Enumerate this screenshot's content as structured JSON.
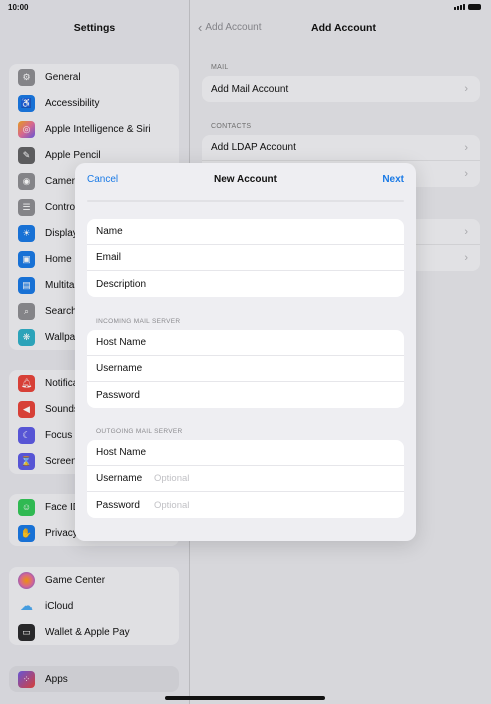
{
  "status_bar": {
    "time": "10:00"
  },
  "sidebar": {
    "title": "Settings",
    "groups": [
      [
        {
          "label": "General",
          "icon": "gear-icon",
          "color": "#8e8e93"
        },
        {
          "label": "Accessibility",
          "icon": "accessibility-icon",
          "color": "#1a7ae6"
        },
        {
          "label": "Apple Intelligence & Siri",
          "icon": "siri-icon",
          "color": "#e8709a"
        },
        {
          "label": "Apple Pencil",
          "icon": "pencil-icon",
          "color": "#636366"
        },
        {
          "label": "Camera",
          "icon": "camera-icon",
          "color": "#8e8e93"
        },
        {
          "label": "Control Centre",
          "icon": "control-centre-icon",
          "color": "#8e8e93"
        },
        {
          "label": "Display & Brightness",
          "icon": "display-icon",
          "color": "#1a7ae6"
        },
        {
          "label": "Home Screen & App Library",
          "icon": "home-screen-icon",
          "color": "#1a7ae6"
        },
        {
          "label": "Multitasking & Gestures",
          "icon": "multitasking-icon",
          "color": "#1a7ae6"
        },
        {
          "label": "Search",
          "icon": "search-icon",
          "color": "#8e8e93"
        },
        {
          "label": "Wallpaper",
          "icon": "wallpaper-icon",
          "color": "#30b0c7"
        }
      ],
      [
        {
          "label": "Notifications",
          "icon": "bell-icon",
          "color": "#e8453c"
        },
        {
          "label": "Sounds",
          "icon": "speaker-icon",
          "color": "#e8453c"
        },
        {
          "label": "Focus",
          "icon": "moon-icon",
          "color": "#5e5ce6"
        },
        {
          "label": "Screen Time",
          "icon": "hourglass-icon",
          "color": "#5e5ce6"
        }
      ],
      [
        {
          "label": "Face ID & Passcode",
          "icon": "face-id-icon",
          "color": "#34c759"
        },
        {
          "label": "Privacy & Security",
          "icon": "hand-icon",
          "color": "#1a7ae6"
        }
      ],
      [
        {
          "label": "Game Center",
          "icon": "game-center-icon",
          "color": "#ff9f0a"
        },
        {
          "label": "iCloud",
          "icon": "cloud-icon",
          "color": "#4aa8f0"
        },
        {
          "label": "Wallet & Apple Pay",
          "icon": "wallet-icon",
          "color": "#2c2c2e"
        }
      ],
      [
        {
          "label": "Apps",
          "icon": "apps-icon",
          "color": "#6e5ce6"
        }
      ]
    ]
  },
  "detail": {
    "back_label": "Add Account",
    "title": "Add Account",
    "mail_header": "MAIL",
    "mail_items": [
      "Add Mail Account"
    ],
    "contacts_header": "CONTACTS",
    "contacts_items": [
      "Add LDAP Account",
      ""
    ],
    "calendars_items": [
      "",
      ""
    ]
  },
  "modal": {
    "cancel": "Cancel",
    "title": "New Account",
    "next": "Next",
    "account_fields": [
      {
        "label": "Name",
        "value": "",
        "placeholder": ""
      },
      {
        "label": "Email",
        "value": "",
        "placeholder": ""
      },
      {
        "label": "Description",
        "value": "",
        "placeholder": ""
      }
    ],
    "incoming_header": "INCOMING MAIL SERVER",
    "incoming_fields": [
      {
        "label": "Host Name",
        "value": "",
        "placeholder": ""
      },
      {
        "label": "Username",
        "value": "",
        "placeholder": ""
      },
      {
        "label": "Password",
        "value": "",
        "placeholder": ""
      }
    ],
    "outgoing_header": "OUTGOING MAIL SERVER",
    "outgoing_fields": [
      {
        "label": "Host Name",
        "value": "",
        "placeholder": ""
      },
      {
        "label": "Username",
        "value": "",
        "placeholder": "Optional"
      },
      {
        "label": "Password",
        "value": "",
        "placeholder": "Optional"
      }
    ]
  }
}
